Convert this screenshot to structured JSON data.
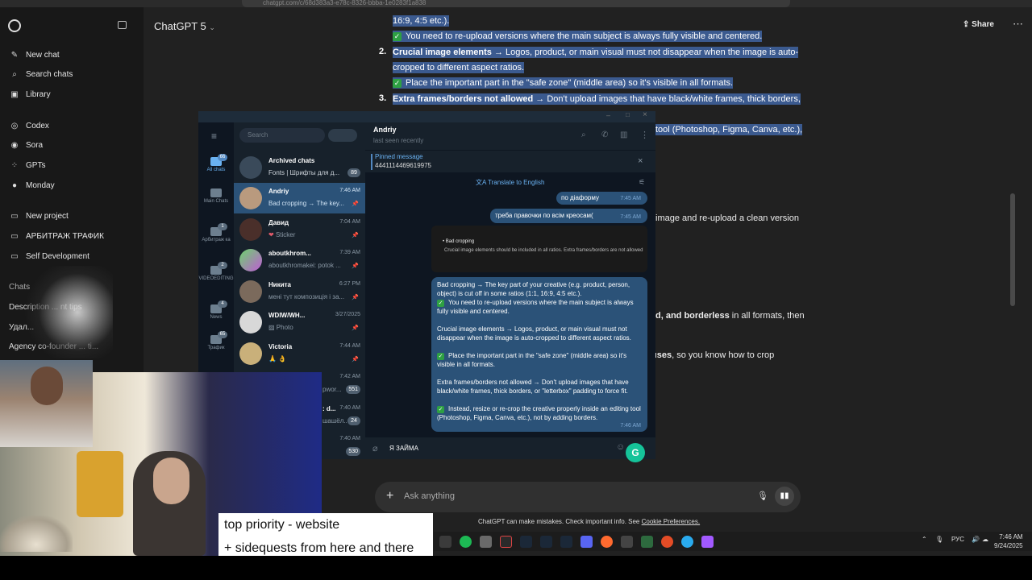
{
  "browser": {
    "url": "chatgpt.com/c/68d383a3-e78c-8326-bbba-1e0283f1a838"
  },
  "chatgpt": {
    "sidebar": {
      "items": [
        {
          "label": "New chat",
          "icon": "new-chat-icon"
        },
        {
          "label": "Search chats",
          "icon": "search-icon"
        },
        {
          "label": "Library",
          "icon": "library-icon"
        },
        {
          "label": "Codex",
          "icon": "codex-icon"
        },
        {
          "label": "Sora",
          "icon": "sora-icon"
        },
        {
          "label": "GPTs",
          "icon": "gpts-icon"
        },
        {
          "label": "Monday",
          "icon": "monday-avatar-icon"
        },
        {
          "label": "New project",
          "icon": "folder-icon"
        },
        {
          "label": "АРБИТРАЖ ТРАФИК",
          "icon": "folder-icon"
        },
        {
          "label": "Self Development",
          "icon": "folder-icon"
        }
      ],
      "chats_heading": "Chats",
      "chat_items": [
        "Description ... nt tips",
        "Удал...",
        "Agency co-founder ... ti..."
      ]
    },
    "model_label": "ChatGPT 5",
    "share_label": "Share",
    "content": {
      "line0": "16:9, 4:5 etc.).",
      "line1": "You need to re-upload versions where the main subject is always fully visible and centered.",
      "item2_num": "2.",
      "item2_bold": "Crucial image elements",
      "item2_rest": "→ Logos, product, or main visual must not disappear when the image is auto-",
      "item2_line2": "cropped to different aspect ratios.",
      "item2_check": "Place the important part in the \"safe zone\" (middle area) so it's visible in all formats.",
      "item3_num": "3.",
      "item3_bold": "Extra frames/borders not allowed",
      "item3_rest": "→ Don't upload images that have black/white frames, thick borders,",
      "frag_tool": "tool (Photoshop, Figma, Canva, etc.),",
      "frag_image": "image and re-upload a clean version",
      "frag_borderless_bold": "d, and borderless",
      "frag_borderless_rest": "in all formats, then",
      "frag_uses_bold": "uses",
      "frag_uses_rest": ", so you know how to crop"
    },
    "composer_placeholder": "Ask anything",
    "disclaimer": "ChatGPT can make mistakes. Check important info. See",
    "disclaimer_link": "Cookie Preferences."
  },
  "telegram": {
    "search_placeholder": "Search",
    "rail": [
      {
        "label": "All chats",
        "badge": "66"
      },
      {
        "label": "Main Chats",
        "badge": ""
      },
      {
        "label": "Арбитраж ка",
        "badge": "1"
      },
      {
        "label": "VIDEOEDITING",
        "badge": "2"
      },
      {
        "label": "News",
        "badge": "4"
      },
      {
        "label": "Трафик",
        "badge": "65"
      }
    ],
    "chats": [
      {
        "name": "Archived chats",
        "preview": "Fonts | Шрифты для д...",
        "time": "",
        "badge": "89"
      },
      {
        "name": "Andriy",
        "preview": "Bad cropping → The key...",
        "time": "7:46 AM",
        "badge": ""
      },
      {
        "name": "Давид",
        "preview": "Sticker",
        "time": "7:04 AM",
        "badge": ""
      },
      {
        "name": "aboutkhrom...",
        "preview": "aboutkhromakei: potok ...",
        "time": "7:39 AM",
        "badge": ""
      },
      {
        "name": "Никита",
        "preview": "мені тут композиція і за...",
        "time": "6:27 PM",
        "badge": ""
      },
      {
        "name": "WDIW/WH...",
        "preview": "Photo",
        "time": "3/27/2025",
        "badge": ""
      },
      {
        "name": "Victoria",
        "preview": "🙏 👌",
        "time": "7:44 AM",
        "badge": ""
      },
      {
        "name": "",
        "preview": "pwor...",
        "time": "7:42 AM",
        "badge": "551"
      },
      {
        "name": ": d...",
        "preview": "шашёл...",
        "time": "7:40 AM",
        "badge": "24"
      },
      {
        "name": "",
        "preview": "",
        "time": "7:40 AM",
        "badge": "530"
      }
    ],
    "header_name": "Andriy",
    "header_status": "last seen recently",
    "pinned_title": "Pinned message",
    "pinned_value": "4441114469619975",
    "translate_label": "Translate to English",
    "msg1": "по діаформу",
    "msg1_time": "7:45 AM",
    "msg2": "треба правочки по всім креосам(",
    "msg2_time": "7:45 AM",
    "card_title": "Bad cropping",
    "card_text": "Crucial image elements should be included in all ratios. Extra frames/borders are not allowed",
    "big_msg": {
      "p1": "Bad cropping → The key part of your creative (e.g. product, person, object) is cut off in some ratios (1:1, 16:9, 4:5 etc.).",
      "p1b": "You need to re-upload versions where the main subject is always fully visible and centered.",
      "p2": "Crucial image elements → Logos, product, or main visual must not disappear when the image is auto-cropped to different aspect ratios.",
      "p2b": "Place the important part in the \"safe zone\" (middle area) so it's visible in all formats.",
      "p3": "Extra frames/borders not allowed → Don't upload images that have black/white frames, thick borders, or \"letterbox\" padding to force fit.",
      "p3b": "Instead, resize or re-crop the creative properly inside an editing tool (Photoshop, Figma, Canva, etc.), not by adding borders.",
      "time": "7:46 AM"
    },
    "input_value": "Я ЗАЙМА"
  },
  "overlay": {
    "line1": "top priority - website",
    "line2": "+ sidequests from here and there"
  },
  "taskbar": {
    "lang": "РУС",
    "time": "7:46 AM",
    "date": "9/24/2025"
  }
}
